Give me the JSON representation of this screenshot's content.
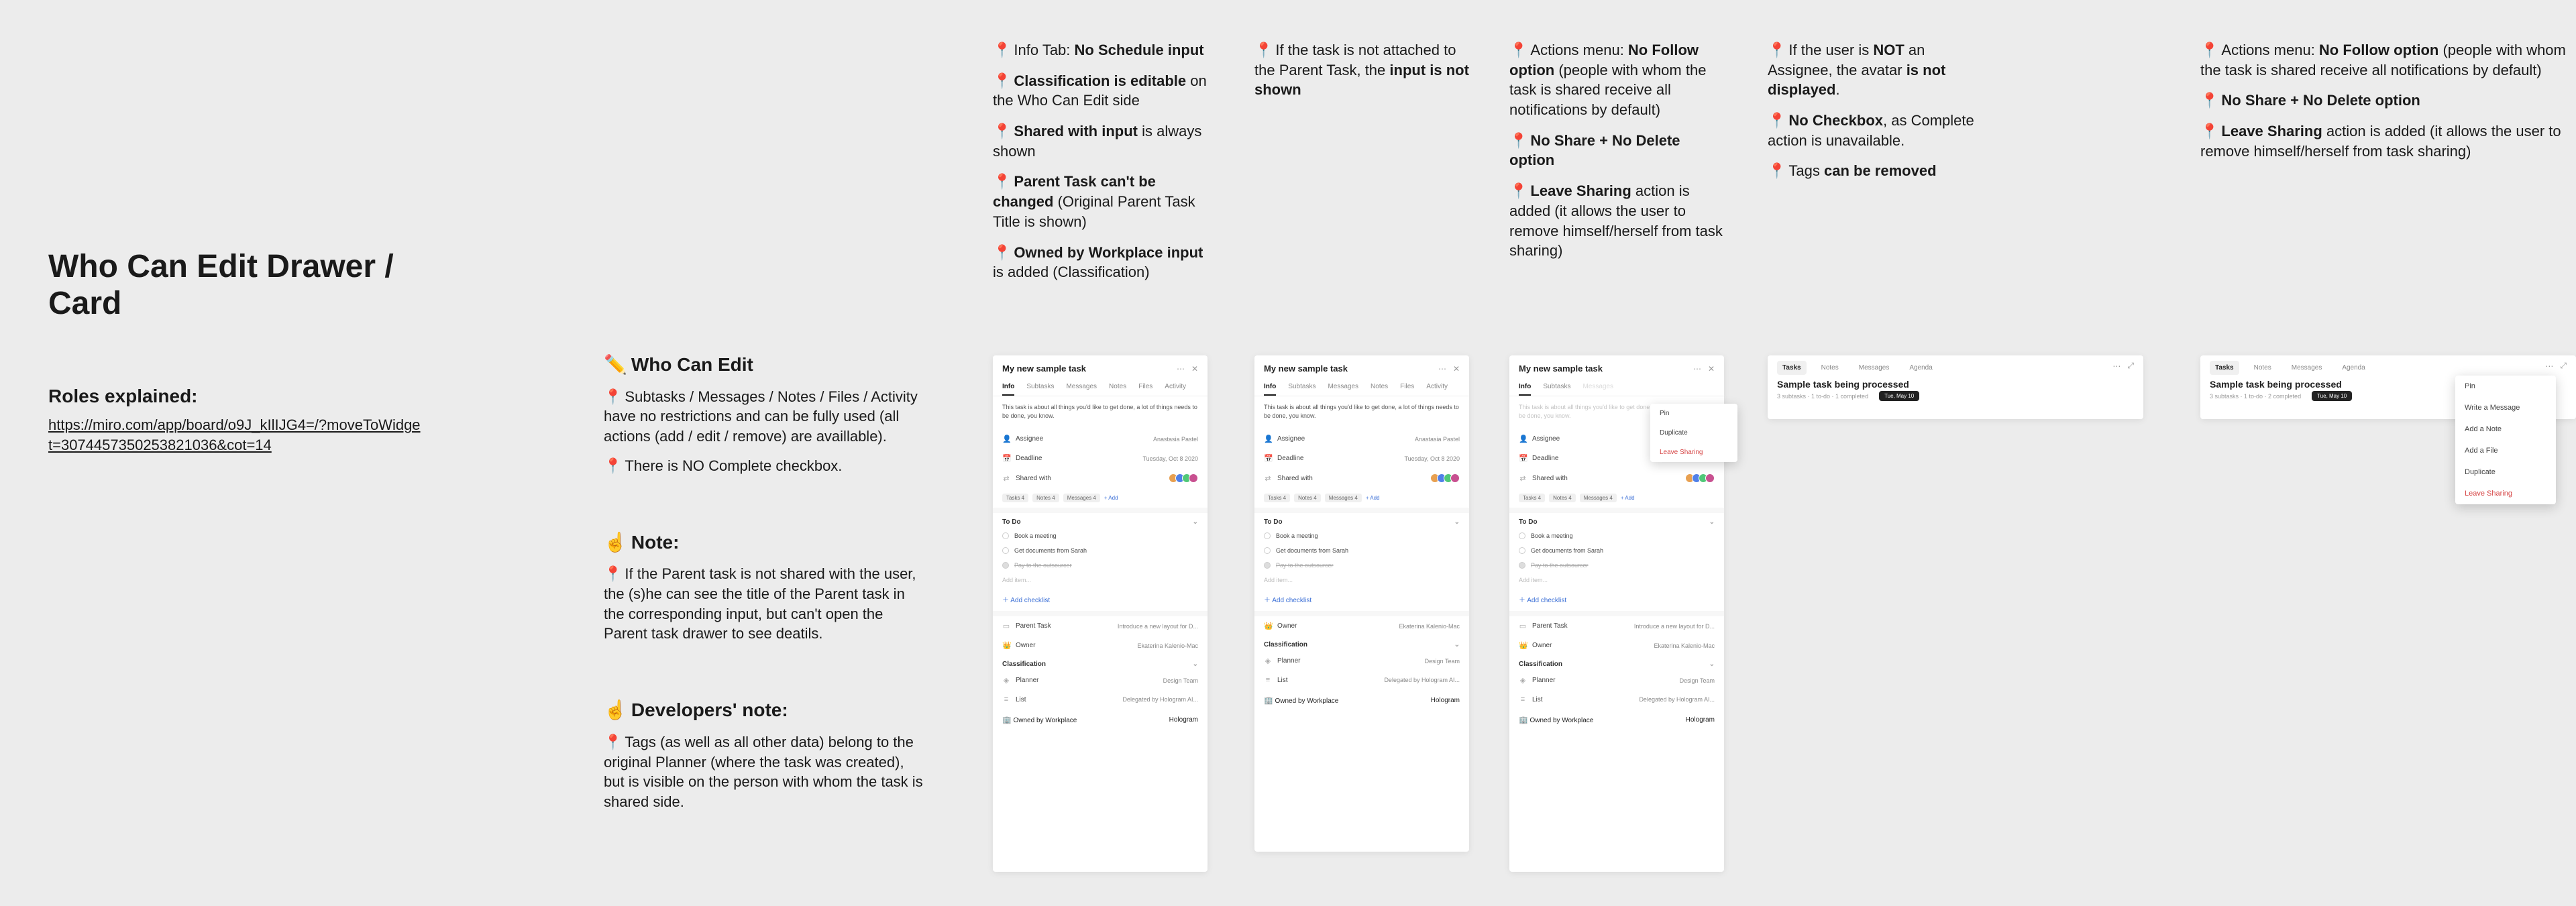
{
  "title": "Who Can Edit Drawer / Card",
  "roles": {
    "heading": "Roles explained:",
    "link": "https://miro.com/app/board/o9J_kIlIJG4=/?moveToWidget=3074457350253821036&cot=14"
  },
  "center": {
    "who_h": "Who Can Edit",
    "who_l1a": "Subtasks / Messages / Notes / Files / Activity have no restrictions and can be fully used (all actions (add / edit / remove) are availlable).",
    "who_l2a": "There is NO Complete checkbox.",
    "note_h": "Note:",
    "note_l1": "If the Parent task is not shared with the user, the (s)he can see the title of the Parent task in the corresponding input, but can't open the Parent task drawer to see deatils.",
    "dev_h": "Developers' note:",
    "dev_l1": "Tags (as well as all other data) belong to the original Planner (where the task was created), but is visible on the person with whom the task is shared side."
  },
  "colA": {
    "l1a": "Info Tab: ",
    "l1b": "No Schedule input",
    "l2a": "Classification is editable",
    "l2b": " on the Who Can Edit side",
    "l3a": "Shared with input",
    "l3b": " is always shown",
    "l4a": "Parent Task can't be changed",
    "l4b": " (Original Parent Task Title is shown)",
    "l5a": "Owned by Workplace input",
    "l5b": " is added (Classification)"
  },
  "colB": {
    "l1a": "If the task is not attached to the Parent Task, the ",
    "l1b": "input is not shown"
  },
  "colC": {
    "l1a": "Actions menu: ",
    "l1b": "No Follow option",
    "l1c": " (people with whom the task is shared receive all notifications by default)",
    "l2a": "No Share + No Delete option",
    "l3a": "Leave Sharing",
    "l3b": " action is added (it allows the user to remove himself/herself from task sharing)"
  },
  "colD": {
    "l1a": "If the user is ",
    "l1b": "NOT",
    "l1c": " an Assignee, the avatar ",
    "l1d": "is not displayed",
    "l1e": ".",
    "l2a": "No Checkbox",
    "l2b": ", as Complete action is unavailable.",
    "l3a": "Tags ",
    "l3b": "can be removed"
  },
  "colE": {
    "l1a": "Actions menu: ",
    "l1b": "No Follow option",
    "l1c": " (people with whom the task is shared receive all notifications by default)",
    "l2a": "No Share + No Delete option",
    "l3a": "Leave Sharing",
    "l3b": " action is added (it allows the user to remove himself/herself from task sharing)"
  },
  "card": {
    "title": "My new sample task",
    "tabs": [
      "Info",
      "Subtasks",
      "Messages",
      "Notes",
      "Files",
      "Activity"
    ],
    "desc": "This task is about all things you'd like to get done, a lot of things needs to be done, you know.",
    "assignee_lbl": "Assignee",
    "assignee_val": "Anastasia Pastel",
    "deadline_lbl": "Deadline",
    "deadline_val": "Tuesday, Oct 8 2020",
    "shared_lbl": "Shared with",
    "tags": [
      "Tasks 4",
      "Notes 4",
      "Messages 4"
    ],
    "addtag": "+ Add",
    "todo_h": "To Do",
    "todo": [
      "Book a meeting",
      "Get documents from Sarah",
      "Pay to the outsourcer"
    ],
    "additem": "Add item...",
    "addchk": "Add checklist",
    "parent_lbl": "Parent Task",
    "parent_val": "Introduce a new layout for D...",
    "owner_lbl": "Owner",
    "owner_val": "Ekaterina Kalenio-Mac",
    "class_h": "Classification",
    "planner_lbl": "Planner",
    "planner_val": "Design Team",
    "list_lbl": "List",
    "list_val": "Delegated by Hologram AI...",
    "owned_lbl": "Owned by Workplace",
    "owned_val": "Hologram"
  },
  "menuC": {
    "pin": "Pin",
    "dup": "Duplicate",
    "leave": "Leave Sharing"
  },
  "wide": {
    "tabs": [
      "Tasks",
      "Notes",
      "Messages",
      "Agenda"
    ],
    "title": "Sample task being processed",
    "sub_a": "3 subtasks · 1 to-do · 1 completed",
    "sub_b": "3 subtasks · 1 to-do · 2 completed",
    "date": "Tue, May 10"
  },
  "floatMenu": {
    "pin": "Pin",
    "write": "Write a Message",
    "note": "Add a Note",
    "file": "Add a File",
    "dup": "Duplicate",
    "leave": "Leave Sharing"
  }
}
